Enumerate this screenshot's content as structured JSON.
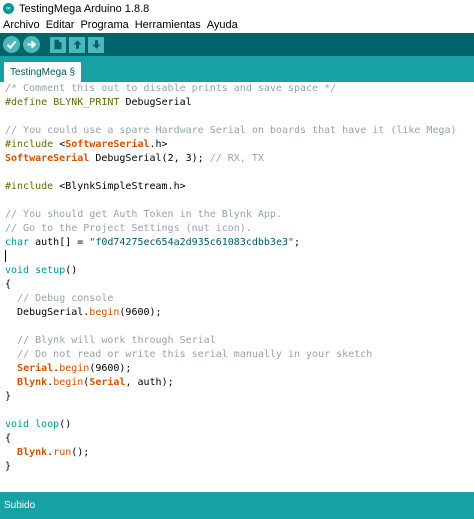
{
  "window": {
    "title": "TestingMega Arduino 1.8.8",
    "icon": "arduino-logo-icon"
  },
  "menu": [
    "Archivo",
    "Editar",
    "Programa",
    "Herramientas",
    "Ayuda"
  ],
  "toolbar": {
    "buttons": [
      "verify-icon",
      "upload-icon",
      "new-icon",
      "open-icon",
      "save-icon"
    ]
  },
  "tab": {
    "label": "TestingMega §"
  },
  "code": [
    [
      {
        "t": "/* Comment this out to disable prints and save space */",
        "c": "c"
      }
    ],
    [
      {
        "t": "#define",
        "c": "pp"
      },
      {
        "t": " "
      },
      {
        "t": "BLYNK_PRINT",
        "c": "pp"
      },
      {
        "t": " DebugSerial"
      }
    ],
    [],
    [
      {
        "t": "// You could use a spare Hardware Serial on boards that have it (like Mega)",
        "c": "c"
      }
    ],
    [
      {
        "t": "#include",
        "c": "pp"
      },
      {
        "t": " <"
      },
      {
        "t": "SoftwareSerial",
        "c": "kwb"
      },
      {
        "t": ".h>"
      }
    ],
    [
      {
        "t": "SoftwareSerial",
        "c": "kwb"
      },
      {
        "t": " DebugSerial(2, 3); "
      },
      {
        "t": "// RX, TX",
        "c": "c"
      }
    ],
    [],
    [
      {
        "t": "#include",
        "c": "pp"
      },
      {
        "t": " <BlynkSimpleStream.h>"
      }
    ],
    [],
    [
      {
        "t": "// You should get Auth Token in the Blynk App.",
        "c": "c"
      }
    ],
    [
      {
        "t": "// Go to the Project Settings (nut icon).",
        "c": "c"
      }
    ],
    [
      {
        "t": "char",
        "c": "kw"
      },
      {
        "t": " auth[] = "
      },
      {
        "t": "\"f0d74275ec654a2d935c61083cdbb3e3\"",
        "c": "str"
      },
      {
        "t": ";"
      }
    ],
    [
      {
        "cursor": true
      }
    ],
    [
      {
        "t": "void",
        "c": "kw"
      },
      {
        "t": " "
      },
      {
        "t": "setup",
        "c": "kw"
      },
      {
        "t": "()"
      }
    ],
    [
      {
        "t": "{"
      }
    ],
    [
      {
        "t": "  "
      },
      {
        "t": "// Debug console",
        "c": "c"
      }
    ],
    [
      {
        "t": "  DebugSerial."
      },
      {
        "t": "begin",
        "c": "fn"
      },
      {
        "t": "(9600);"
      }
    ],
    [],
    [
      {
        "t": "  "
      },
      {
        "t": "// Blynk will work through Serial",
        "c": "c"
      }
    ],
    [
      {
        "t": "  "
      },
      {
        "t": "// Do not read or write this serial manually in your sketch",
        "c": "c"
      }
    ],
    [
      {
        "t": "  "
      },
      {
        "t": "Serial",
        "c": "kwb"
      },
      {
        "t": "."
      },
      {
        "t": "begin",
        "c": "fn"
      },
      {
        "t": "(9600);"
      }
    ],
    [
      {
        "t": "  "
      },
      {
        "t": "Blynk",
        "c": "kwb"
      },
      {
        "t": "."
      },
      {
        "t": "begin",
        "c": "fn"
      },
      {
        "t": "("
      },
      {
        "t": "Serial",
        "c": "kwb"
      },
      {
        "t": ", auth);"
      }
    ],
    [
      {
        "t": "}"
      }
    ],
    [],
    [
      {
        "t": "void",
        "c": "kw"
      },
      {
        "t": " "
      },
      {
        "t": "loop",
        "c": "kw"
      },
      {
        "t": "()"
      }
    ],
    [
      {
        "t": "{"
      }
    ],
    [
      {
        "t": "  "
      },
      {
        "t": "Blynk",
        "c": "kwb"
      },
      {
        "t": "."
      },
      {
        "t": "run",
        "c": "fn"
      },
      {
        "t": "();"
      }
    ],
    [
      {
        "t": "}"
      }
    ]
  ],
  "status": {
    "text": "Subido"
  },
  "colors": {
    "toolbar": "#006468",
    "tabbar": "#17a1a5",
    "status": "#17a1a5",
    "button": "#4db7bb"
  }
}
